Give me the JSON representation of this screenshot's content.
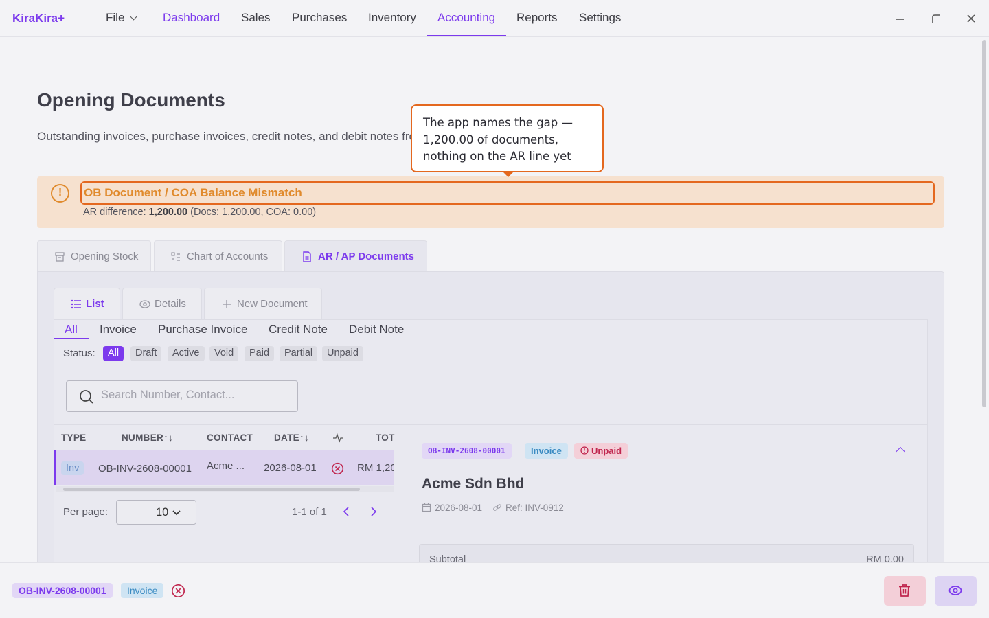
{
  "app": {
    "brand": "KiraKira+"
  },
  "nav": {
    "file": "File",
    "items": [
      "Dashboard",
      "Sales",
      "Purchases",
      "Inventory",
      "Accounting",
      "Reports",
      "Settings"
    ],
    "active": "Accounting"
  },
  "page": {
    "title": "Opening Documents",
    "subtitle": "Outstanding invoices, purchase invoices, credit notes, and debit notes fro"
  },
  "callout": {
    "text": "The app names the gap — 1,200.00 of documents, nothing on the AR line yet"
  },
  "alert": {
    "title": "OB Document / COA Balance Mismatch",
    "label": "AR difference:",
    "amount": "1,200.00",
    "detail": "(Docs: 1,200.00, COA: 0.00)"
  },
  "main_tabs": [
    "Opening Stock",
    "Chart of Accounts",
    "AR / AP Documents"
  ],
  "sub_tabs": [
    "List",
    "Details",
    "New Document"
  ],
  "filter_tabs": [
    "All",
    "Invoice",
    "Purchase Invoice",
    "Credit Note",
    "Debit Note"
  ],
  "status_filter": {
    "label": "Status:",
    "chips": [
      "All",
      "Draft",
      "Active",
      "Void",
      "Paid",
      "Partial",
      "Unpaid"
    ]
  },
  "search": {
    "placeholder": "Search Number, Contact..."
  },
  "table": {
    "headers": [
      "TYPE",
      "NUMBER",
      "CONTACT",
      "DATE",
      "TOT"
    ],
    "rows": [
      {
        "type": "Inv",
        "number": "OB-INV-2608-00001",
        "contact": "Acme ...",
        "date": "2026-08-01",
        "total": "RM 1,20"
      }
    ]
  },
  "pagination": {
    "per_page_label": "Per page:",
    "per_page": "10",
    "count": "1-1 of 1"
  },
  "detail": {
    "number": "OB-INV-2608-00001",
    "kind": "Invoice",
    "status": "Unpaid",
    "contact": "Acme Sdn Bhd",
    "date": "2026-08-01",
    "ref": "Ref: INV-0912",
    "subtotal_label": "Subtotal",
    "subtotal_value": "RM 0.00"
  },
  "bottom_bar": {
    "number": "OB-INV-2608-00001",
    "kind": "Invoice"
  },
  "colors": {
    "accent": "#7c3aed",
    "warning": "#e08a2c",
    "callout_border": "#e4681f",
    "danger": "#c0264e"
  }
}
